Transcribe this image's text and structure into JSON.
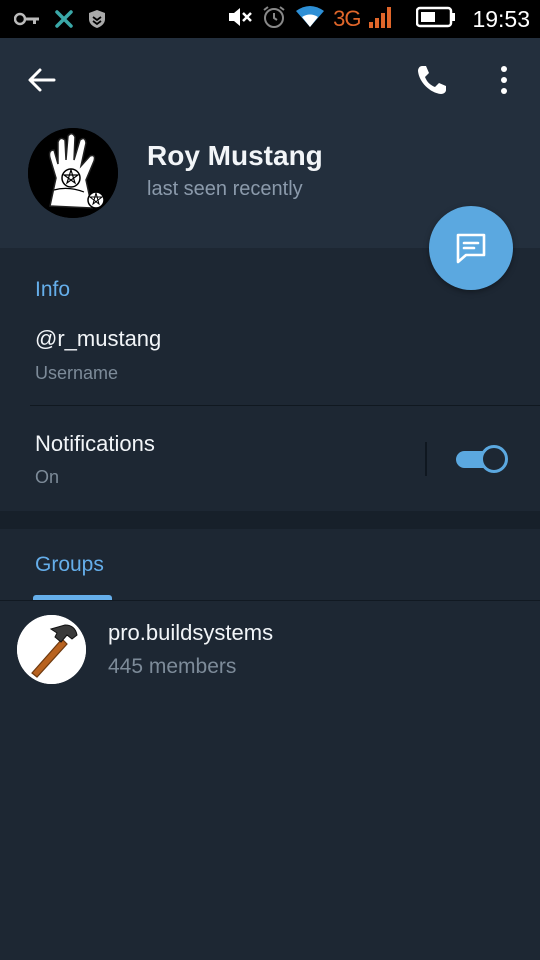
{
  "status_bar": {
    "network": "3G",
    "time": "19:53",
    "icons": [
      "key-icon",
      "x-logo-icon",
      "shield-icon",
      "mute-icon",
      "alarm-icon",
      "wifi-icon",
      "signal-icon",
      "battery-icon"
    ]
  },
  "profile": {
    "name": "Roy Mustang",
    "status": "last seen recently"
  },
  "info": {
    "title": "Info",
    "username_value": "@r_mustang",
    "username_label": "Username",
    "notifications_label": "Notifications",
    "notifications_value": "On",
    "notifications_enabled": true
  },
  "groups": {
    "tab_label": "Groups",
    "items": [
      {
        "name": "pro.buildsystems",
        "members": "445 members"
      }
    ]
  },
  "colors": {
    "accent": "#65aeea",
    "fab": "#5ba8e0",
    "header_bg": "#232f3d",
    "body_bg": "#1d2733"
  }
}
